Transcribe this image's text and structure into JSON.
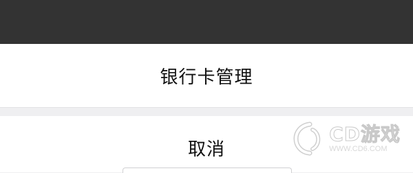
{
  "action_sheet": {
    "option_label": "银行卡管理",
    "cancel_label": "取消"
  },
  "watermark": {
    "brand": "CD游戏",
    "url": "WWW.CD6.COM"
  }
}
